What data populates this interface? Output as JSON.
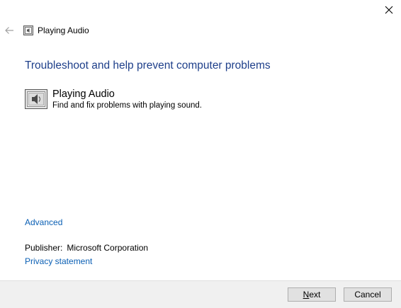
{
  "window": {
    "title": "Playing Audio"
  },
  "main": {
    "heading": "Troubleshoot and help prevent computer problems",
    "troubleshooter": {
      "title": "Playing Audio",
      "description": "Find and fix problems with playing sound."
    },
    "advanced_label": "Advanced",
    "publisher_label": "Publisher:",
    "publisher_value": "Microsoft Corporation",
    "privacy_label": "Privacy statement"
  },
  "footer": {
    "next_label_accel": "N",
    "next_label_rest": "ext",
    "cancel_label": "Cancel"
  },
  "colors": {
    "heading": "#1e3f8a",
    "link": "#0a5fb4",
    "footer_bg": "#f0f0f0"
  },
  "icons": {
    "close": "close-icon",
    "back": "back-arrow-icon",
    "title": "audio-troubleshooter-icon"
  }
}
